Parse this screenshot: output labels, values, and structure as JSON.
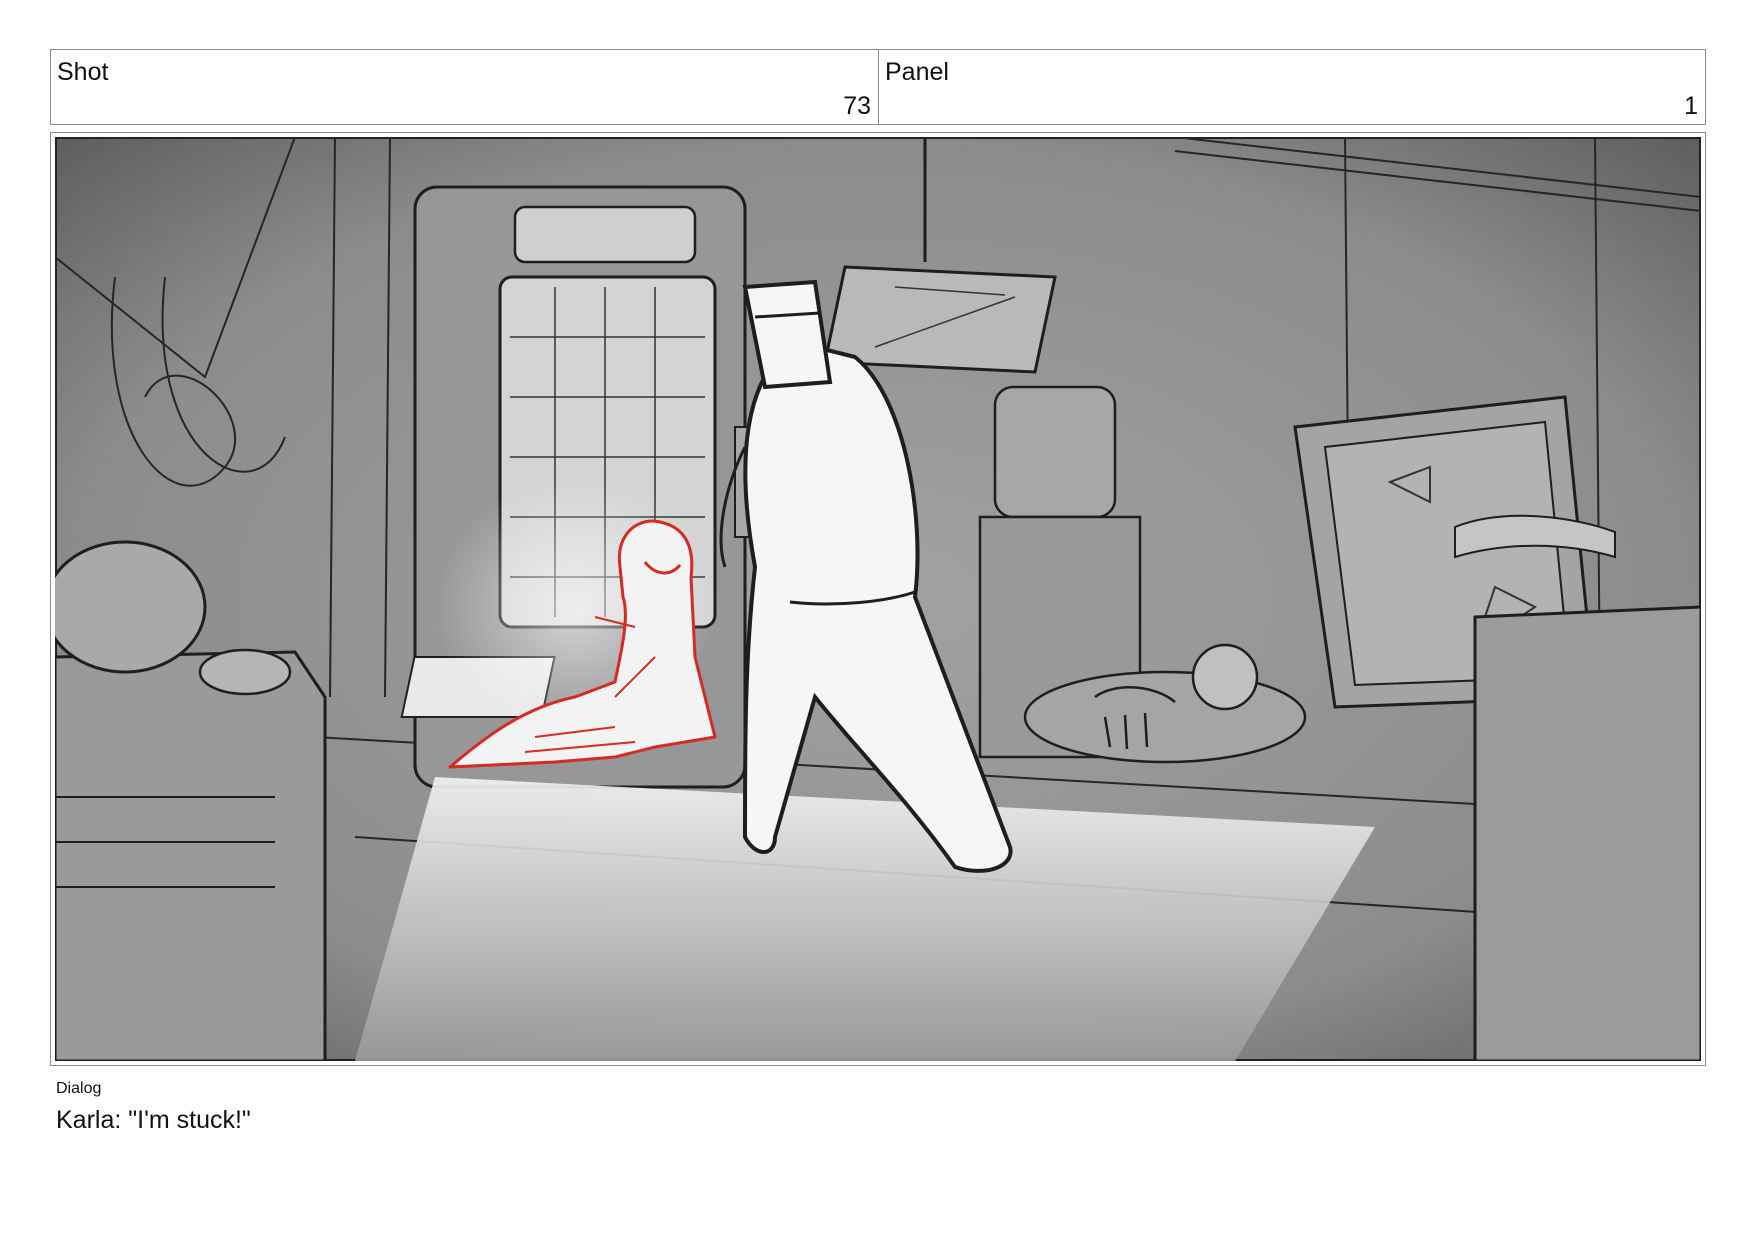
{
  "header": {
    "shot_label": "Shot",
    "shot_number": "73",
    "panel_label": "Panel",
    "panel_number": "1"
  },
  "frame": {
    "picture": "storyboard-sketch",
    "colors": {
      "background": "#8f8f8f",
      "line": "#1e1e1e",
      "highlight": "#f7f7f7",
      "character_red": "#d62a22"
    }
  },
  "dialog": {
    "label": "Dialog",
    "text": "Karla: \"I'm stuck!\""
  }
}
